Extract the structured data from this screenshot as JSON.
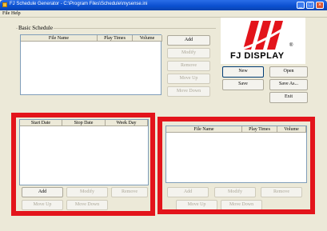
{
  "window": {
    "title": "FJ Schedule Generator - C:\\Program Files\\Schedule\\mysense.ini",
    "minimize": "_",
    "maximize": "□",
    "close": "×"
  },
  "menu": [
    "File",
    "Help"
  ],
  "basic_schedule": {
    "label": "Basic Schedule",
    "columns": [
      "File Name",
      "Play Times",
      "Volume"
    ],
    "buttons": [
      "Add",
      "Modify",
      "Remove",
      "Move Up",
      "Move Down"
    ]
  },
  "logo": {
    "text": "FJ DISPLAY",
    "registered": "®"
  },
  "file_buttons": [
    "New",
    "Open",
    "Save",
    "Save As...",
    "Exit"
  ],
  "advanced_schedule": {
    "columns": [
      "Start Date",
      "Stop Date",
      "Week Day"
    ],
    "buttons": [
      "Add",
      "Modify",
      "Remove",
      "Move Up",
      "Move Down"
    ]
  },
  "right_schedule": {
    "columns": [
      "File Name",
      "Play Times",
      "Volume"
    ],
    "buttons": [
      "Add",
      "Modify",
      "Remove",
      "Move Up",
      "Move Down"
    ]
  },
  "colors": {
    "highlight_box": "#e3141b",
    "title_bar": "#0a4fcf"
  }
}
